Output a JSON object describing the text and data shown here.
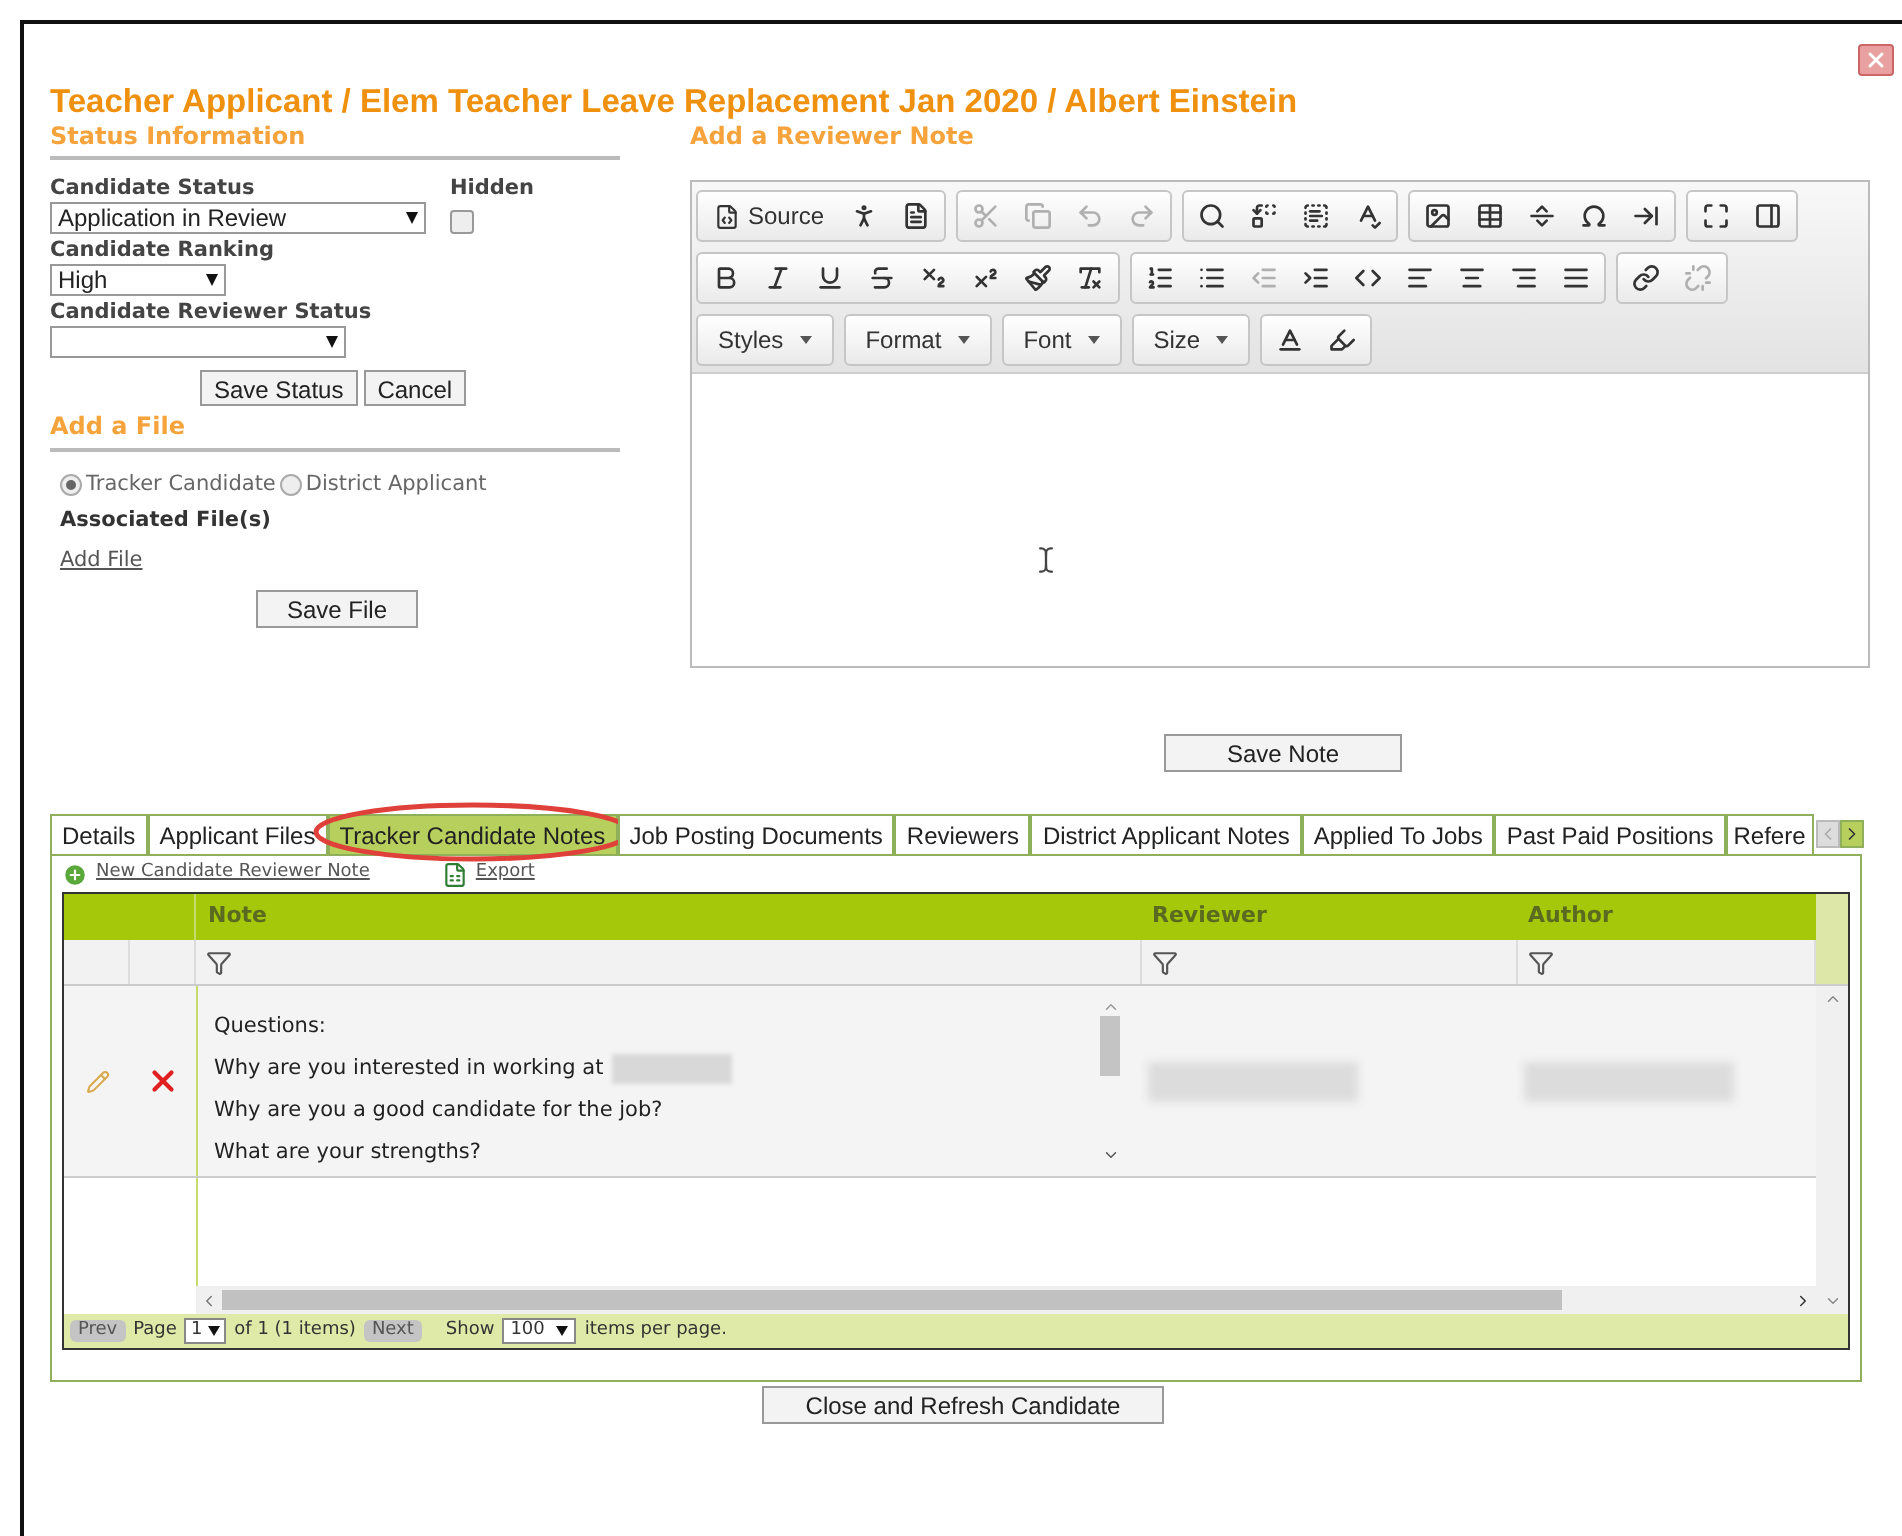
{
  "title": "Teacher Applicant / Elem Teacher Leave Replacement Jan 2020 / Albert Einstein",
  "status": {
    "heading": "Status Information",
    "fields": [
      {
        "label": "Candidate Status",
        "value": "Application in Review"
      },
      {
        "label": "Candidate Ranking",
        "value": "High"
      },
      {
        "label": "Candidate Reviewer Status"
      }
    ],
    "hidden": {
      "label": "Hidden",
      "checked": false
    },
    "buttons": [
      "Save Status",
      "Cancel"
    ]
  },
  "file": {
    "heading": "Add a File",
    "options": [
      {
        "label": "Tracker Candidate",
        "selected": true
      },
      {
        "label": "District Applicant",
        "selected": false
      }
    ],
    "associated_label": "Associated File(s)",
    "link": "Add File",
    "button": "Save File"
  },
  "note": {
    "heading": "Add a Reviewer Note",
    "toolbar": [
      [
        [
          {
            "kind": "source",
            "label": "Source",
            "disabled": false
          },
          {
            "kind": "accessibility",
            "disabled": false
          },
          {
            "kind": "preview",
            "disabled": false
          }
        ],
        [
          {
            "kind": "cut",
            "disabled": true
          },
          {
            "kind": "copy",
            "disabled": true
          },
          {
            "kind": "undo",
            "disabled": true
          },
          {
            "kind": "redo",
            "disabled": true
          }
        ],
        [
          {
            "kind": "find",
            "disabled": false
          },
          {
            "kind": "replace",
            "disabled": false
          },
          {
            "kind": "selectall",
            "disabled": false
          },
          {
            "kind": "spellcheck",
            "disabled": false
          }
        ],
        [
          {
            "kind": "image",
            "disabled": false
          },
          {
            "kind": "table",
            "disabled": false
          },
          {
            "kind": "rule",
            "disabled": false
          },
          {
            "kind": "symbol",
            "disabled": false
          },
          {
            "kind": "pagebreak",
            "disabled": false
          }
        ],
        [
          {
            "kind": "maximize",
            "disabled": false
          },
          {
            "kind": "blocks",
            "disabled": false
          }
        ]
      ],
      [
        [
          {
            "kind": "bold",
            "disabled": false
          },
          {
            "kind": "italic",
            "disabled": false
          },
          {
            "kind": "underline",
            "disabled": false
          },
          {
            "kind": "strike",
            "disabled": false
          },
          {
            "kind": "subscript",
            "disabled": false
          },
          {
            "kind": "superscript",
            "disabled": false
          },
          {
            "kind": "copyformat",
            "disabled": false
          },
          {
            "kind": "removeformat",
            "disabled": false
          }
        ],
        [
          {
            "kind": "numbered",
            "disabled": false
          },
          {
            "kind": "bulleted",
            "disabled": false
          },
          {
            "kind": "outdent",
            "disabled": true
          },
          {
            "kind": "indent",
            "disabled": false
          },
          {
            "kind": "div",
            "disabled": false
          },
          {
            "kind": "alignleft",
            "disabled": false
          },
          {
            "kind": "aligncenter",
            "disabled": false
          },
          {
            "kind": "alignright",
            "disabled": false
          },
          {
            "kind": "justify",
            "disabled": false
          }
        ],
        [
          {
            "kind": "link",
            "disabled": false
          },
          {
            "kind": "unlink",
            "disabled": true
          }
        ]
      ],
      [
        [
          {
            "kind": "combo",
            "label": "Styles",
            "disabled": false
          }
        ],
        [
          {
            "kind": "combo",
            "label": "Format",
            "disabled": false
          }
        ],
        [
          {
            "kind": "combo",
            "label": "Font",
            "disabled": false
          }
        ],
        [
          {
            "kind": "combo",
            "label": "Size",
            "disabled": false
          }
        ],
        [
          {
            "kind": "textcolor",
            "disabled": false
          },
          {
            "kind": "bgcolor",
            "disabled": false
          }
        ]
      ]
    ],
    "button": "Save Note"
  },
  "tabs": [
    {
      "label": "Details",
      "selected": false
    },
    {
      "label": "Applicant Files",
      "selected": false
    },
    {
      "label": "Tracker Candidate Notes",
      "selected": true
    },
    {
      "label": "Job Posting Documents",
      "selected": false
    },
    {
      "label": "Reviewers",
      "selected": false
    },
    {
      "label": "District Applicant Notes",
      "selected": false
    },
    {
      "label": "Applied To Jobs",
      "selected": false
    },
    {
      "label": "Past Paid Positions",
      "selected": false
    },
    {
      "label": "Refere",
      "selected": false
    }
  ],
  "grid": {
    "new_link": "New Candidate Reviewer Note",
    "export_link": "Export",
    "columns": [
      "Note",
      "Reviewer",
      "Author"
    ],
    "rows": [
      {
        "note_lines": [
          "Questions:",
          "Why are you interested in working at",
          "Why are you a good candidate for the job?",
          "What are your strengths?"
        ]
      }
    ]
  },
  "pager": {
    "prev": "Prev",
    "page_label": "Page",
    "page": "1",
    "of_text": "of 1 (1 items)",
    "next": "Next",
    "show_label": "Show",
    "page_size": "100",
    "suffix": "items per page."
  },
  "close_button": "Close and Refresh Candidate"
}
